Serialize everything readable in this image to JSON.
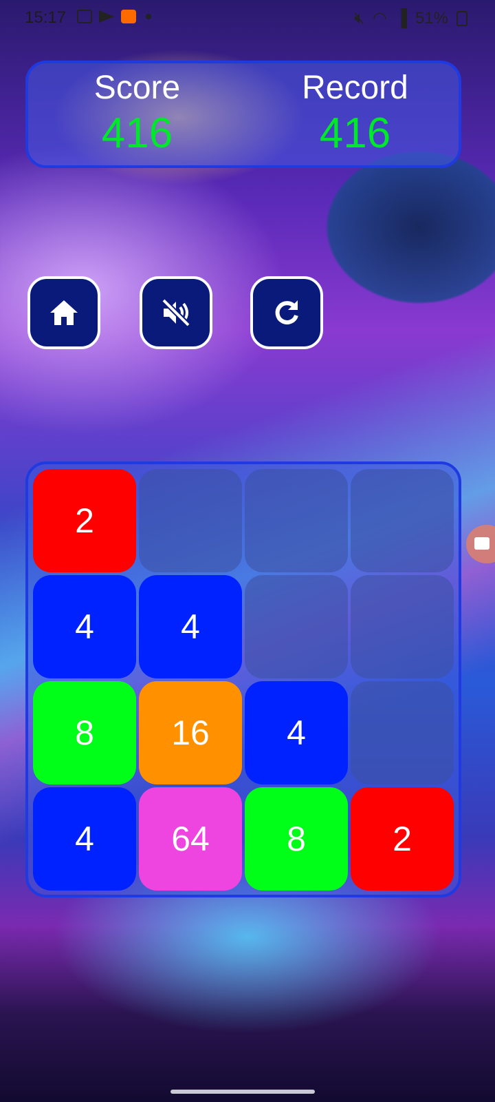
{
  "status_bar": {
    "time": "15:17",
    "battery_text": "51%"
  },
  "scoreboard": {
    "score_label": "Score",
    "score_value": "416",
    "record_label": "Record",
    "record_value": "416"
  },
  "controls": {
    "home_icon": "home-icon",
    "sound_icon": "sound-muted-icon",
    "restart_icon": "restart-icon"
  },
  "board": {
    "rows": [
      [
        "2",
        "",
        "",
        ""
      ],
      [
        "4",
        "4",
        "",
        ""
      ],
      [
        "8",
        "16",
        "4",
        ""
      ],
      [
        "4",
        "64",
        "8",
        "2"
      ]
    ]
  },
  "colors": {
    "tile_2": "#ff0000",
    "tile_4": "#0022ff",
    "tile_8": "#00ff18",
    "tile_16": "#ff9000",
    "tile_64": "#ee44e0",
    "score_value": "#00e82a",
    "panel_border": "#1e3ae0",
    "button_bg": "#0a1a7a"
  }
}
